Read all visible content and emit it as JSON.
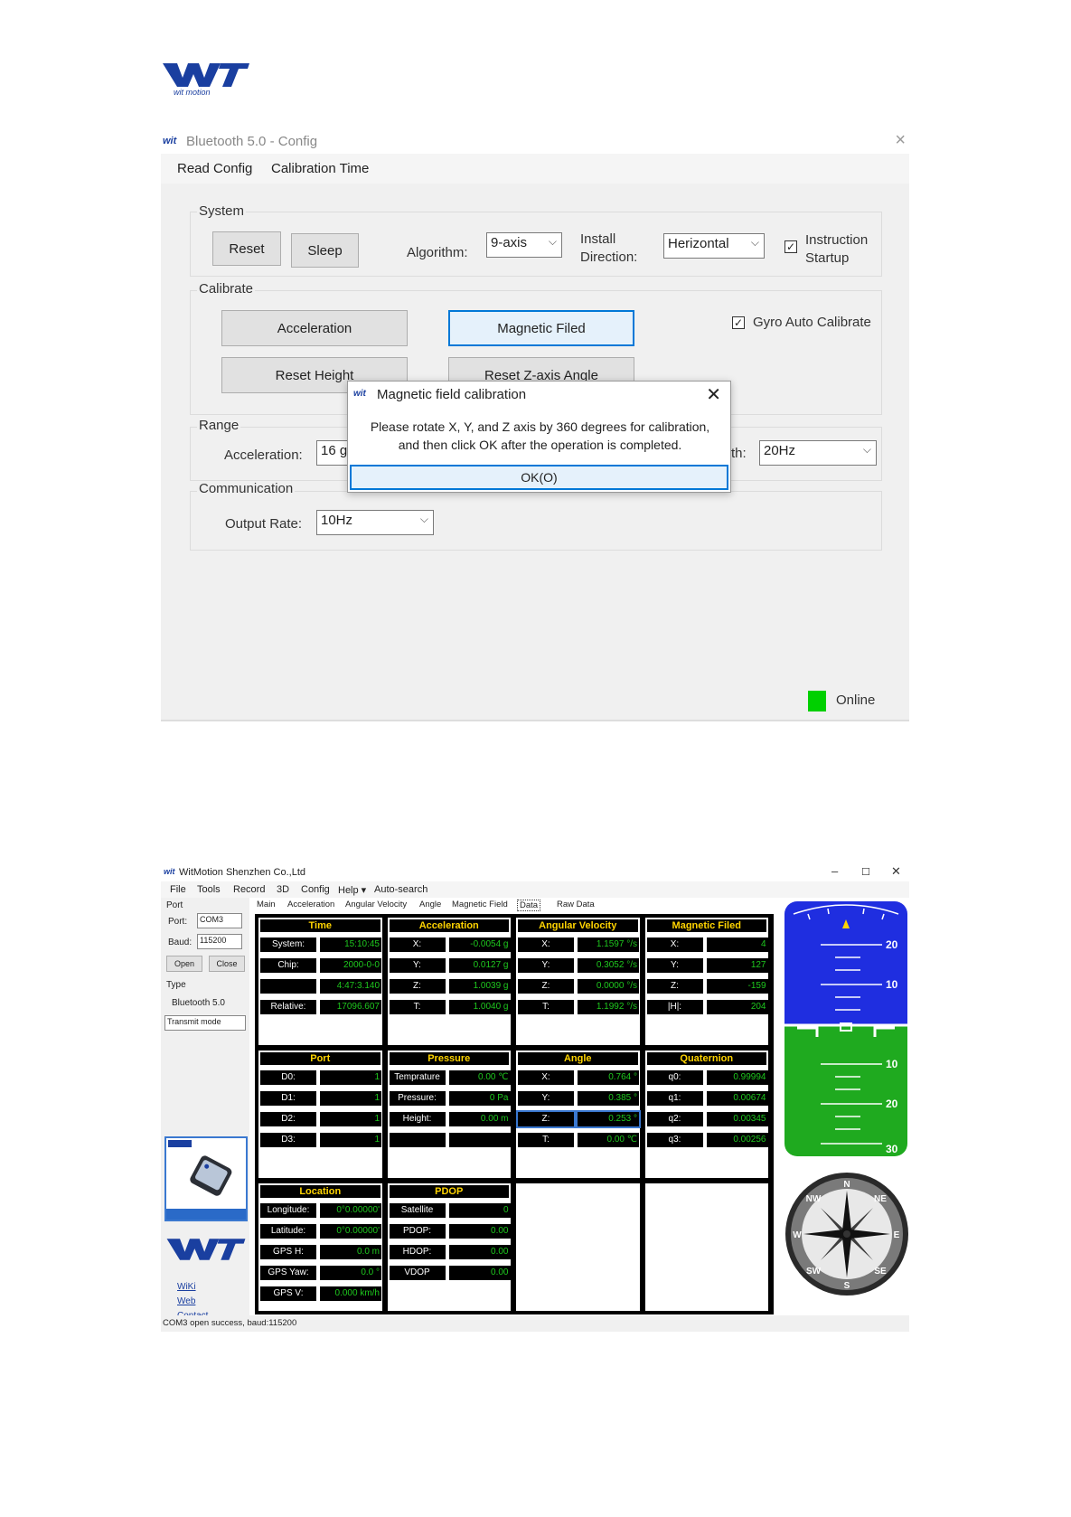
{
  "config_window": {
    "title": "Bluetooth 5.0 - Config",
    "close": "×",
    "menu": [
      "Read Config",
      "Calibration Time"
    ],
    "system": {
      "label": "System",
      "reset": "Reset",
      "sleep": "Sleep",
      "algorithm_label": "Algorithm:",
      "algorithm_value": "9-axis",
      "install_label_1": "Install",
      "install_label_2": "Direction:",
      "install_value": "Herizontal",
      "instruction_label_1": "Instruction",
      "instruction_label_2": "Startup",
      "instruction_checked": "✓"
    },
    "calibrate": {
      "label": "Calibrate",
      "acceleration": "Acceleration",
      "magnetic": "Magnetic Filed",
      "reset_height": "Reset Height",
      "reset_z": "Reset Z-axis Angle",
      "gyro_label": "Gyro Auto Calibrate",
      "gyro_checked": "✓"
    },
    "range": {
      "label": "Range",
      "accel_label": "Acceleration:",
      "accel_value": "16 g",
      "bw_label": "th:",
      "bw_value": "20Hz"
    },
    "communication": {
      "label": "Communication",
      "rate_label": "Output Rate:",
      "rate_value": "10Hz"
    },
    "status": "Online",
    "status_color": "#00d000",
    "dialog": {
      "title": "Magnetic field calibration",
      "close": "✕",
      "message_1": "Please rotate X, Y, and Z axis by 360 degrees for calibration,",
      "message_2": "and then click OK after the operation is completed.",
      "ok": "OK(O)"
    }
  },
  "main_window": {
    "title": "WitMotion Shenzhen Co.,Ltd",
    "controls": [
      "–",
      "☐",
      "✕"
    ],
    "menu": [
      "File",
      "Tools",
      "Record",
      "3D",
      "Config",
      "Help ▾",
      "Auto-search"
    ],
    "left": {
      "port_group": "Port",
      "port_label": "Port:",
      "port_value": "COM3",
      "baud_label": "Baud:",
      "baud_value": "115200",
      "open": "Open",
      "close": "Close",
      "type_group": "Type",
      "type_value": "Bluetooth 5.0",
      "mode_value": "Transmit mode",
      "links": [
        "WiKi",
        "Web",
        "Contact"
      ]
    },
    "tabs": [
      "Main",
      "Acceleration",
      "Angular Velocity",
      "Angle",
      "Magnetic Field",
      "Data",
      "Raw Data"
    ],
    "panels": {
      "time": {
        "title": "Time",
        "rows": [
          [
            "System:",
            "15:10:45"
          ],
          [
            "Chip:",
            "2000-0-0"
          ],
          [
            "",
            "4:47:3.140"
          ],
          [
            "Relative:",
            "17096.607"
          ]
        ]
      },
      "acceleration": {
        "title": "Acceleration",
        "rows": [
          [
            "X:",
            "-0.0054 g"
          ],
          [
            "Y:",
            "0.0127 g"
          ],
          [
            "Z:",
            "1.0039 g"
          ],
          [
            "T:",
            "1.0040 g"
          ]
        ]
      },
      "angular": {
        "title": "Angular Velocity",
        "rows": [
          [
            "X:",
            "1.1597 °/s"
          ],
          [
            "Y:",
            "0.3052 °/s"
          ],
          [
            "Z:",
            "0.0000 °/s"
          ],
          [
            "T:",
            "1.1992 °/s"
          ]
        ]
      },
      "magnetic": {
        "title": "Magnetic Filed",
        "rows": [
          [
            "X:",
            "4"
          ],
          [
            "Y:",
            "127"
          ],
          [
            "Z:",
            "-159"
          ],
          [
            "|H|:",
            "204"
          ]
        ]
      },
      "port": {
        "title": "Port",
        "rows": [
          [
            "D0:",
            "1"
          ],
          [
            "D1:",
            "1"
          ],
          [
            "D2:",
            "1"
          ],
          [
            "D3:",
            "1"
          ]
        ]
      },
      "pressure": {
        "title": "Pressure",
        "rows": [
          [
            "Temprature",
            "0.00 ℃"
          ],
          [
            "Pressure:",
            "0 Pa"
          ],
          [
            "Height:",
            "0.00 m"
          ],
          [
            "",
            ""
          ]
        ]
      },
      "angle": {
        "title": "Angle",
        "rows": [
          [
            "X:",
            "0.764 °"
          ],
          [
            "Y:",
            "0.385 °"
          ],
          [
            "Z:",
            "0.253 °"
          ],
          [
            "T:",
            "0.00 ℃"
          ]
        ]
      },
      "quaternion": {
        "title": "Quaternion",
        "rows": [
          [
            "q0:",
            "0.99994"
          ],
          [
            "q1:",
            "0.00674"
          ],
          [
            "q2:",
            "0.00345"
          ],
          [
            "q3:",
            "0.00256"
          ]
        ]
      },
      "location": {
        "title": "Location",
        "rows": [
          [
            "Longitude:",
            "0°0.00000'"
          ],
          [
            "Latitude:",
            "0°0.00000'"
          ],
          [
            "GPS H:",
            "0.0 m"
          ],
          [
            "GPS Yaw:",
            "0.0 °"
          ],
          [
            "GPS V:",
            "0.000 km/h"
          ]
        ]
      },
      "pdop": {
        "title": "PDOP",
        "rows": [
          [
            "Satellite",
            "0"
          ],
          [
            "PDOP:",
            "0.00"
          ],
          [
            "HDOP:",
            "0.00"
          ],
          [
            "VDOP",
            "0.00"
          ]
        ]
      }
    },
    "attitude": {
      "sky": "#1f2ee0",
      "ground": "#1faa1f",
      "labels": [
        "20",
        "10",
        "10",
        "20",
        "30"
      ]
    },
    "compass": {
      "labels": [
        "N",
        "NE",
        "E",
        "SE",
        "S",
        "SW",
        "W",
        "NW"
      ]
    },
    "status": "COM3 open success, baud:115200"
  }
}
